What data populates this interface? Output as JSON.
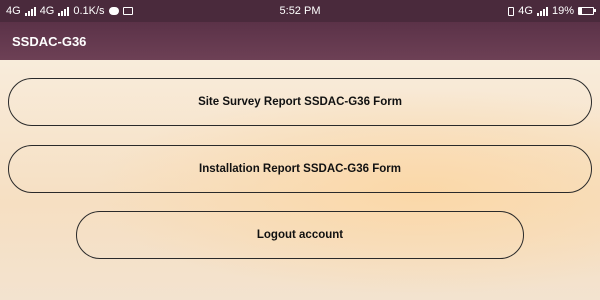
{
  "status_bar": {
    "network_1": "4G",
    "network_2": "4G",
    "data_speed": "0.1K/s",
    "time": "5:52 PM",
    "network_right": "4G",
    "battery_percent": "19%",
    "battery_level": 0.19
  },
  "app_bar": {
    "title": "SSDAC-G36"
  },
  "buttons": {
    "site_survey": "Site Survey Report SSDAC-G36 Form",
    "installation": "Installation Report SSDAC-G36 Form",
    "logout": "Logout account"
  }
}
